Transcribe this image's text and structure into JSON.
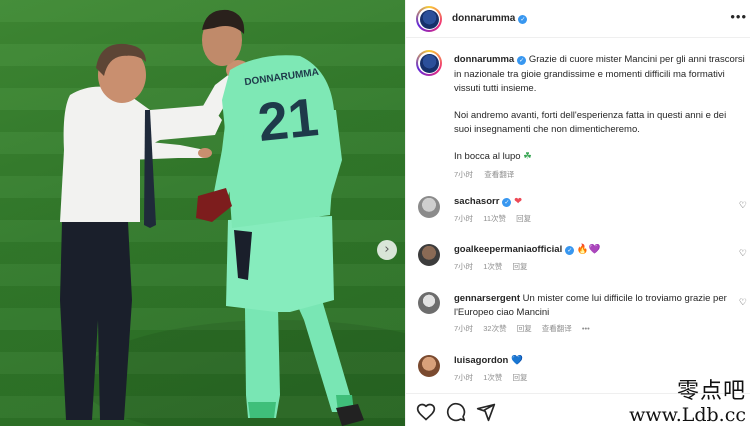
{
  "post": {
    "username": "donnarumma",
    "caption_p1": "Grazie di cuore mister Mancini per gli anni trascorsi in nazionale tra gioie grandissime e momenti difficili ma formativi vissuti tutti insieme.",
    "caption_p2": "Noi andremo avanti, forti dell'esperienza fatta in questi anni e dei suoi insegnamenti che non dimenticheremo.",
    "caption_p3": "In bocca al lupo",
    "clover_emoji": "☘",
    "time": "7小时",
    "translate": "查看翻译",
    "more_icon": "more-dots-icon",
    "more_glyph": "•••"
  },
  "photo": {
    "jersey_number": "21",
    "jersey_name": "DONNARUMMA",
    "next_glyph": "›"
  },
  "comments": [
    {
      "username": "sachasorr",
      "text": "",
      "emoji": "❤",
      "emoji_color": "#ed4956",
      "time": "7小时",
      "likes": "11次赞",
      "reply": "回复",
      "translate": ""
    },
    {
      "username": "goalkeepermaniaofficial",
      "text": "",
      "emoji": "🔥💜",
      "emoji_color": "#f09433",
      "time": "7小时",
      "likes": "1次赞",
      "reply": "回复",
      "translate": ""
    },
    {
      "username": "gennarsergent",
      "text": "Un mister come lui difficile lo troviamo grazie per l'Europeo ciao Mancini",
      "emoji": "",
      "time": "7小时",
      "likes": "32次赞",
      "reply": "回复",
      "translate": "查看翻译",
      "more": "•••"
    },
    {
      "username": "luisagordon",
      "text": "",
      "emoji": "💙",
      "emoji_color": "#3897f0",
      "time": "7小时",
      "likes": "1次赞",
      "reply": "回复",
      "translate": ""
    }
  ],
  "comment_like_glyph": "♡",
  "watermark": {
    "line1": "零点吧",
    "line2": "www.Ldb.cc"
  },
  "colors": {
    "verified": "#3897f0",
    "heart": "#ed4956",
    "pitch": "#3a8431",
    "jersey": "#7ee8b5"
  }
}
